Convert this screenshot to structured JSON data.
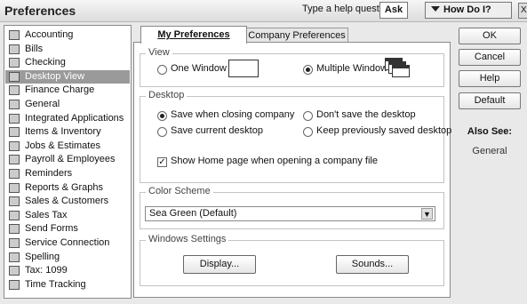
{
  "window": {
    "title": "Preferences",
    "help_prompt": "Type a help question",
    "ask_label": "Ask",
    "how_do_i_label": "How Do I?",
    "close_label": "X"
  },
  "sidebar": {
    "selected_index": 3,
    "items": [
      {
        "label": "Accounting",
        "icon": "accounting-icon"
      },
      {
        "label": "Bills",
        "icon": "bills-icon"
      },
      {
        "label": "Checking",
        "icon": "checking-icon"
      },
      {
        "label": "Desktop View",
        "icon": "desktop-view-icon"
      },
      {
        "label": "Finance Charge",
        "icon": "finance-charge-icon"
      },
      {
        "label": "General",
        "icon": "general-icon"
      },
      {
        "label": "Integrated Applications",
        "icon": "integrated-applications-icon"
      },
      {
        "label": "Items & Inventory",
        "icon": "items-inventory-icon"
      },
      {
        "label": "Jobs & Estimates",
        "icon": "jobs-estimates-icon"
      },
      {
        "label": "Payroll & Employees",
        "icon": "payroll-icon"
      },
      {
        "label": "Reminders",
        "icon": "reminders-icon"
      },
      {
        "label": "Reports & Graphs",
        "icon": "reports-graphs-icon"
      },
      {
        "label": "Sales & Customers",
        "icon": "sales-customers-icon"
      },
      {
        "label": "Sales Tax",
        "icon": "sales-tax-icon"
      },
      {
        "label": "Send Forms",
        "icon": "send-forms-icon"
      },
      {
        "label": "Service Connection",
        "icon": "service-connection-icon"
      },
      {
        "label": "Spelling",
        "icon": "spelling-icon"
      },
      {
        "label": "Tax: 1099",
        "icon": "tax-1099-icon"
      },
      {
        "label": "Time Tracking",
        "icon": "time-tracking-icon"
      }
    ]
  },
  "tabs": {
    "my_preferences": "My Preferences",
    "company_preferences": "Company Preferences"
  },
  "view": {
    "legend": "View",
    "one_window": "One Window",
    "multiple_windows": "Multiple Windows",
    "selected": "multiple_windows"
  },
  "desktop": {
    "legend": "Desktop",
    "save_when_closing": "Save when closing company",
    "dont_save": "Don't save the desktop",
    "save_current": "Save current desktop",
    "keep_previously": "Keep previously saved desktop",
    "selected": "save_when_closing",
    "show_home_page": "Show Home page when opening a company file",
    "show_home_page_checked": true
  },
  "color_scheme": {
    "legend": "Color Scheme",
    "value": "Sea Green (Default)"
  },
  "windows_settings": {
    "legend": "Windows Settings",
    "display_label": "Display...",
    "sounds_label": "Sounds..."
  },
  "buttons": {
    "ok": "OK",
    "cancel": "Cancel",
    "help": "Help",
    "default": "Default"
  },
  "also_see": {
    "title": "Also See:",
    "links": [
      "General"
    ]
  }
}
